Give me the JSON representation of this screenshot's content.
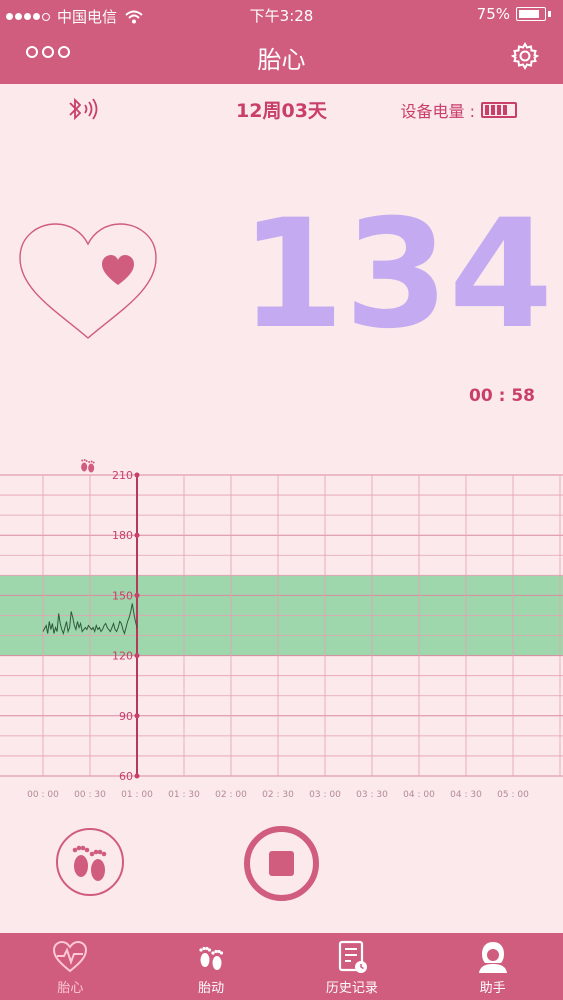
{
  "status_bar": {
    "carrier": "中国电信",
    "time": "下午3:28",
    "battery": "75%"
  },
  "nav": {
    "title": "胎心"
  },
  "info": {
    "gestation": "12周03天",
    "device_battery_label": "设备电量 :"
  },
  "monitor": {
    "heart_rate": "134",
    "elapsed": "00 : 58"
  },
  "tabs": [
    {
      "label": "胎心",
      "icon": "heart-monitor-icon",
      "active": true
    },
    {
      "label": "胎动",
      "icon": "footprints-icon",
      "active": false
    },
    {
      "label": "历史记录",
      "icon": "history-document-icon",
      "active": false
    },
    {
      "label": "助手",
      "icon": "assistant-icon",
      "active": false
    }
  ],
  "colors": {
    "primary": "#d05c7e",
    "bpm": "#c4aaf0",
    "normal_band": "#9ed7ac",
    "background": "#fbe9ec"
  },
  "chart_data": {
    "type": "line",
    "x_tick_labels": [
      "00 : 00",
      "00 : 30",
      "01 : 00",
      "01 : 30",
      "02 : 00",
      "02 : 30",
      "03 : 00",
      "03 : 30",
      "04 : 00",
      "04 : 30",
      "05 : 00"
    ],
    "y_tick_labels": [
      "210",
      "180",
      "150",
      "120",
      "90",
      "60"
    ],
    "ylim": [
      60,
      210
    ],
    "xlim_seconds": [
      0,
      300
    ],
    "normal_band": [
      120,
      160
    ],
    "current_time_seconds": 60,
    "fetal_movement_marks_seconds": [
      25
    ],
    "series": [
      {
        "x": [
          0,
          2,
          3,
          4,
          5,
          6,
          7,
          8,
          9,
          10,
          11,
          12,
          13,
          14,
          15,
          16,
          17,
          18,
          19,
          20,
          21,
          22,
          23,
          24,
          25,
          26,
          27,
          28,
          29,
          30,
          31,
          32,
          33,
          34,
          35,
          36,
          37,
          38,
          39,
          40,
          41,
          42,
          43,
          44,
          45,
          46,
          47,
          48,
          49,
          50,
          51,
          52,
          53,
          54,
          55,
          56,
          57,
          58,
          59,
          60
        ],
        "y": [
          132,
          135,
          131,
          137,
          133,
          136,
          131,
          134,
          132,
          141,
          136,
          133,
          131,
          134,
          137,
          132,
          134,
          142,
          139,
          135,
          133,
          137,
          134,
          136,
          132,
          133,
          134,
          133,
          135,
          134,
          133,
          134,
          132,
          135,
          133,
          134,
          132,
          133,
          135,
          136,
          134,
          133,
          132,
          134,
          136,
          133,
          132,
          134,
          137,
          136,
          133,
          131,
          134,
          137,
          139,
          142,
          146,
          141,
          137,
          134
        ]
      }
    ]
  }
}
